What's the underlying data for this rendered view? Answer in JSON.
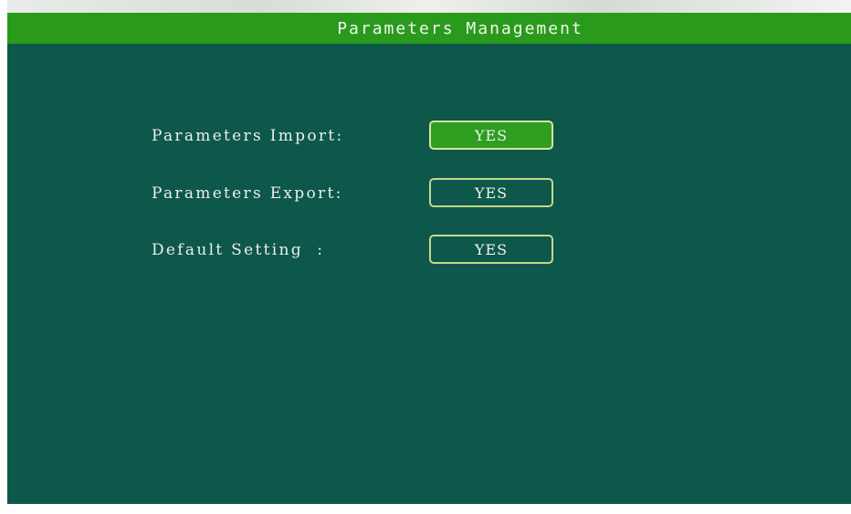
{
  "window": {
    "title": "Parameters Management"
  },
  "rows": [
    {
      "label": "Parameters Import:",
      "button": "YES",
      "selected": true
    },
    {
      "label": "Parameters Export:",
      "button": "YES",
      "selected": false
    },
    {
      "label": "Default Setting  :",
      "button": "YES",
      "selected": false
    }
  ],
  "colors": {
    "background": "#0e574b",
    "title_bar": "#2a9a1d",
    "selected_button": "#2e9d20",
    "button_border": "#c3d98a",
    "text": "#e9f1ea"
  }
}
